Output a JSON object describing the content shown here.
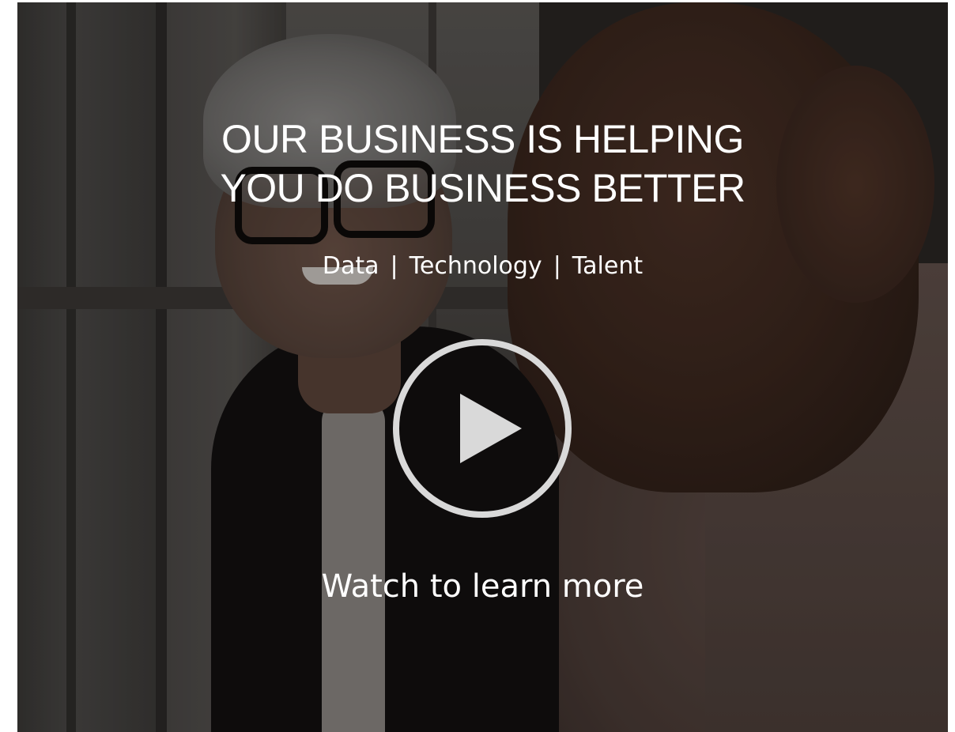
{
  "hero": {
    "headline_line1": "OUR BUSINESS IS HELPING",
    "headline_line2": "YOU DO BUSINESS BETTER",
    "tagline": {
      "items": [
        "Data",
        "Technology",
        "Talent"
      ],
      "separator": "|"
    },
    "play_icon": "play-circle-icon",
    "cta": "Watch to learn more",
    "colors": {
      "text": "#ffffff",
      "play_icon": "#d9d9d9"
    }
  }
}
